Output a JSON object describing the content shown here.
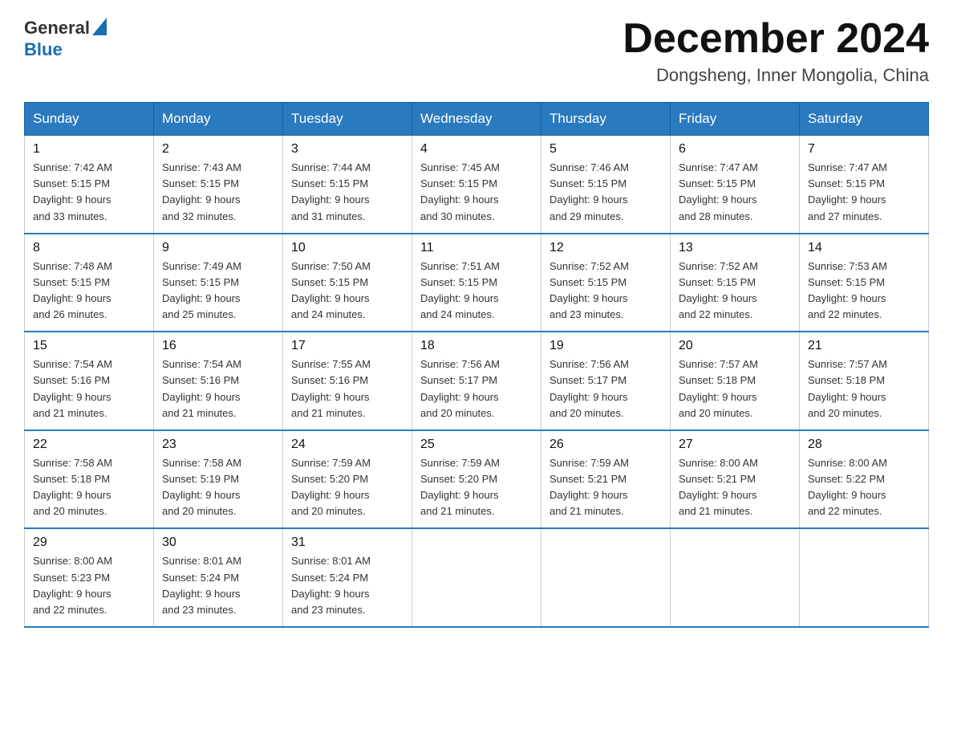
{
  "header": {
    "logo_general": "General",
    "logo_blue": "Blue",
    "title": "December 2024",
    "subtitle": "Dongsheng, Inner Mongolia, China"
  },
  "days_of_week": [
    "Sunday",
    "Monday",
    "Tuesday",
    "Wednesday",
    "Thursday",
    "Friday",
    "Saturday"
  ],
  "weeks": [
    [
      {
        "day": "1",
        "sunrise": "7:42 AM",
        "sunset": "5:15 PM",
        "daylight": "9 hours and 33 minutes."
      },
      {
        "day": "2",
        "sunrise": "7:43 AM",
        "sunset": "5:15 PM",
        "daylight": "9 hours and 32 minutes."
      },
      {
        "day": "3",
        "sunrise": "7:44 AM",
        "sunset": "5:15 PM",
        "daylight": "9 hours and 31 minutes."
      },
      {
        "day": "4",
        "sunrise": "7:45 AM",
        "sunset": "5:15 PM",
        "daylight": "9 hours and 30 minutes."
      },
      {
        "day": "5",
        "sunrise": "7:46 AM",
        "sunset": "5:15 PM",
        "daylight": "9 hours and 29 minutes."
      },
      {
        "day": "6",
        "sunrise": "7:47 AM",
        "sunset": "5:15 PM",
        "daylight": "9 hours and 28 minutes."
      },
      {
        "day": "7",
        "sunrise": "7:47 AM",
        "sunset": "5:15 PM",
        "daylight": "9 hours and 27 minutes."
      }
    ],
    [
      {
        "day": "8",
        "sunrise": "7:48 AM",
        "sunset": "5:15 PM",
        "daylight": "9 hours and 26 minutes."
      },
      {
        "day": "9",
        "sunrise": "7:49 AM",
        "sunset": "5:15 PM",
        "daylight": "9 hours and 25 minutes."
      },
      {
        "day": "10",
        "sunrise": "7:50 AM",
        "sunset": "5:15 PM",
        "daylight": "9 hours and 24 minutes."
      },
      {
        "day": "11",
        "sunrise": "7:51 AM",
        "sunset": "5:15 PM",
        "daylight": "9 hours and 24 minutes."
      },
      {
        "day": "12",
        "sunrise": "7:52 AM",
        "sunset": "5:15 PM",
        "daylight": "9 hours and 23 minutes."
      },
      {
        "day": "13",
        "sunrise": "7:52 AM",
        "sunset": "5:15 PM",
        "daylight": "9 hours and 22 minutes."
      },
      {
        "day": "14",
        "sunrise": "7:53 AM",
        "sunset": "5:15 PM",
        "daylight": "9 hours and 22 minutes."
      }
    ],
    [
      {
        "day": "15",
        "sunrise": "7:54 AM",
        "sunset": "5:16 PM",
        "daylight": "9 hours and 21 minutes."
      },
      {
        "day": "16",
        "sunrise": "7:54 AM",
        "sunset": "5:16 PM",
        "daylight": "9 hours and 21 minutes."
      },
      {
        "day": "17",
        "sunrise": "7:55 AM",
        "sunset": "5:16 PM",
        "daylight": "9 hours and 21 minutes."
      },
      {
        "day": "18",
        "sunrise": "7:56 AM",
        "sunset": "5:17 PM",
        "daylight": "9 hours and 20 minutes."
      },
      {
        "day": "19",
        "sunrise": "7:56 AM",
        "sunset": "5:17 PM",
        "daylight": "9 hours and 20 minutes."
      },
      {
        "day": "20",
        "sunrise": "7:57 AM",
        "sunset": "5:18 PM",
        "daylight": "9 hours and 20 minutes."
      },
      {
        "day": "21",
        "sunrise": "7:57 AM",
        "sunset": "5:18 PM",
        "daylight": "9 hours and 20 minutes."
      }
    ],
    [
      {
        "day": "22",
        "sunrise": "7:58 AM",
        "sunset": "5:18 PM",
        "daylight": "9 hours and 20 minutes."
      },
      {
        "day": "23",
        "sunrise": "7:58 AM",
        "sunset": "5:19 PM",
        "daylight": "9 hours and 20 minutes."
      },
      {
        "day": "24",
        "sunrise": "7:59 AM",
        "sunset": "5:20 PM",
        "daylight": "9 hours and 20 minutes."
      },
      {
        "day": "25",
        "sunrise": "7:59 AM",
        "sunset": "5:20 PM",
        "daylight": "9 hours and 21 minutes."
      },
      {
        "day": "26",
        "sunrise": "7:59 AM",
        "sunset": "5:21 PM",
        "daylight": "9 hours and 21 minutes."
      },
      {
        "day": "27",
        "sunrise": "8:00 AM",
        "sunset": "5:21 PM",
        "daylight": "9 hours and 21 minutes."
      },
      {
        "day": "28",
        "sunrise": "8:00 AM",
        "sunset": "5:22 PM",
        "daylight": "9 hours and 22 minutes."
      }
    ],
    [
      {
        "day": "29",
        "sunrise": "8:00 AM",
        "sunset": "5:23 PM",
        "daylight": "9 hours and 22 minutes."
      },
      {
        "day": "30",
        "sunrise": "8:01 AM",
        "sunset": "5:24 PM",
        "daylight": "9 hours and 23 minutes."
      },
      {
        "day": "31",
        "sunrise": "8:01 AM",
        "sunset": "5:24 PM",
        "daylight": "9 hours and 23 minutes."
      },
      null,
      null,
      null,
      null
    ]
  ],
  "labels": {
    "sunrise": "Sunrise:",
    "sunset": "Sunset:",
    "daylight": "Daylight:"
  }
}
